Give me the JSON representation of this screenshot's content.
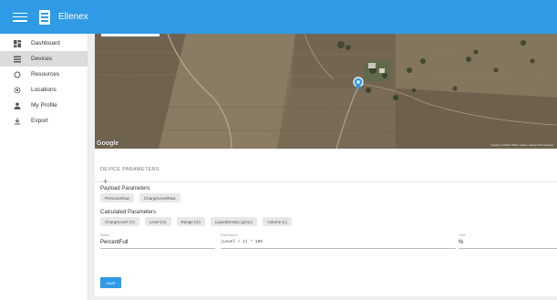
{
  "app": {
    "brand": "Ellenex",
    "brand_color": "#2f9ae6"
  },
  "sidebar": {
    "items": [
      {
        "label": "Dashboard",
        "icon": "dashboard-icon"
      },
      {
        "label": "Devices",
        "icon": "devices-icon",
        "active": true
      },
      {
        "label": "Resources",
        "icon": "resources-icon"
      },
      {
        "label": "Locations",
        "icon": "location-icon"
      },
      {
        "label": "My Profile",
        "icon": "person-icon"
      },
      {
        "label": "Export",
        "icon": "export-icon"
      }
    ]
  },
  "map": {
    "provider": "Google",
    "attribution": "Imagery ©2020 CNES / Airbus, Maxar Technologies"
  },
  "device_parameters": {
    "title": "DEVICE PARAMETERS",
    "payload_title": "Payload Parameters",
    "payload_chips": [
      "PressureRaw",
      "ChargeLevelRaw"
    ],
    "calculated_title": "Calculated Parameters",
    "calculated_chips": [
      "ChargeLevel (V)",
      "Level (m)",
      "Range (m)",
      "LiquidDensity (g/mL)",
      "Volume (L)"
    ],
    "name_field": {
      "label": "Name",
      "value": "PercentFull"
    },
    "expression_field": {
      "label": "Expression",
      "value": "(Level / 2) * 100"
    },
    "unit_field": {
      "label": "Unit",
      "value": "%"
    },
    "add_label": "+",
    "save_label": "SAVE"
  }
}
